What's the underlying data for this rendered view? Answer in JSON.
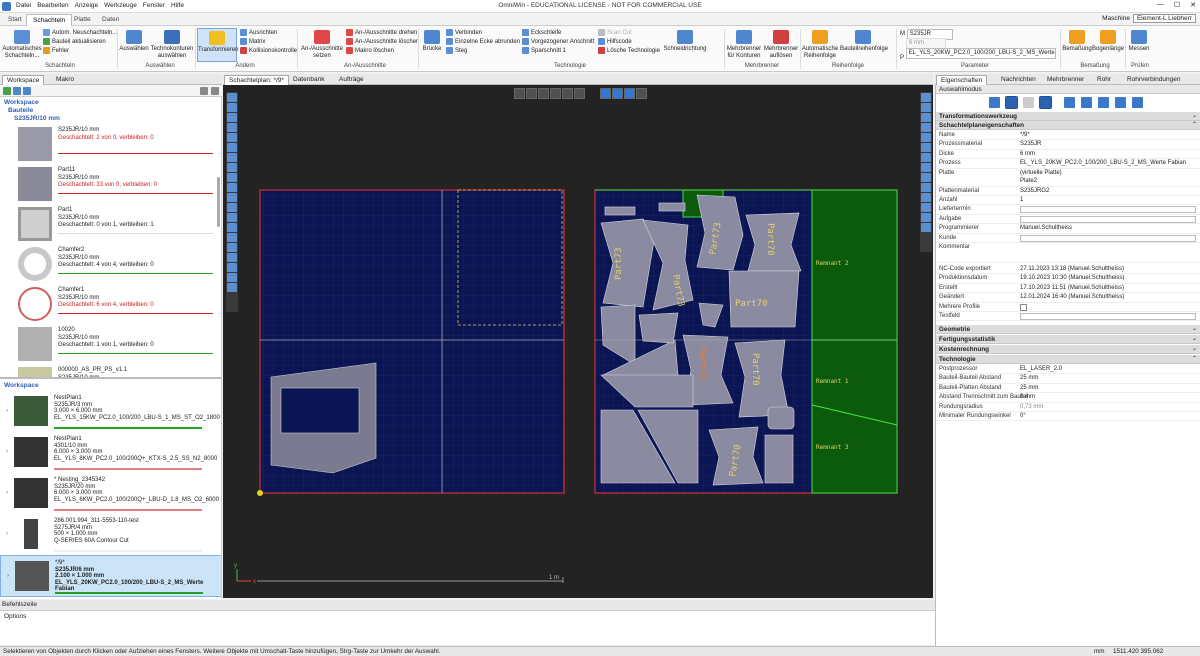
{
  "titlebar": {
    "menu": [
      "Datei",
      "Bearbeiten",
      "Anzeige",
      "Werkzeuge",
      "Fenster",
      "Hilfe"
    ],
    "title": "OmniWin - EDUCATIONAL LICENSE - NOT FOR COMMERCIAL USE",
    "controls": {
      "minimize": "—",
      "maximize": "☐",
      "close": "✕"
    }
  },
  "ribbon_tabs": {
    "tabs": [
      "Start",
      "Schachteln",
      "Platte",
      "Daten"
    ],
    "active": "Schachteln",
    "machine_label": "Maschine",
    "machine_value": "Element-L Liebherr"
  },
  "ribbon": {
    "schachteln": {
      "auto_label": "Automatisches Schachteln...",
      "small": [
        "Autom. Neuschachteln...",
        "Bauteil aktualisieren",
        "Fehler"
      ],
      "group": "Schachteln"
    },
    "auswahlen": {
      "select_label": "Auswählen",
      "contours_label": "Technokonturen auswählen",
      "group": "Auswählen"
    },
    "andern": {
      "transform_label": "Transformieren",
      "small": [
        "Ausrichten",
        "Matrix",
        "Kollisionskontrolle"
      ],
      "group": "Ändern"
    },
    "anaus": {
      "set_label": "An-/Ausschnitte setzen",
      "small": [
        "An-/Ausschnitte drehen",
        "An-/Ausschnitte löschen",
        "Makro löschen"
      ],
      "group": "An-/Ausschnitte"
    },
    "technologie": {
      "bridges_label": "Brücke",
      "small_a": [
        "Verbinden",
        "Einzelne Ecke abrunden",
        "Steg"
      ],
      "small_b": [
        "Eckschleife",
        "Vorgezogener Anschnitt",
        "Sparschnitt 1"
      ],
      "small_c": [
        "Scan Cut",
        "Hilfscode",
        "Lösche Technologie"
      ],
      "direction_label": "Schneidrichtung",
      "group": "Technologie"
    },
    "mehrbrenner": {
      "contours_label": "Mehrbrenner für Konturen",
      "dissolve_label": "Mehrbrenner auflösen",
      "group": "Mehrbrenner"
    },
    "reihenfolge": {
      "auto_label": "Automatische Reihenfolge",
      "parts_label": "Bauteilreihenfolge",
      "group": "Reihenfolge"
    },
    "parameter": {
      "m_label": "M",
      "material": "S235JR",
      "thickness": "6 mm",
      "p_label": "P",
      "process": "EL_YLS_20KW_PC2.0_100/200_LBU-S_2_MS_Werte Fabian",
      "group": "Parameter"
    },
    "bemassung": {
      "dim_label": "Bemaßung",
      "arc_label": "Bogenlänge",
      "group": "Bemaßung"
    },
    "prufen": {
      "measure_label": "Messen",
      "group": "Prüfen"
    }
  },
  "left_panel": {
    "tabs": [
      "Workspace",
      "Makro"
    ],
    "section_workspace": "Workspace",
    "section_parts": "Bauteile",
    "material_group": "S235JR/10 mm",
    "parts": [
      {
        "name": "",
        "material": "S235JR/10 mm",
        "status": "Geschachtelt: 2 von 0, verbleiben: 0",
        "status_color": "#d02020",
        "line_color": "#d02020"
      },
      {
        "name": "Part11",
        "material": "S235JR/10 mm",
        "status": "Geschachtelt: 33 von 0, verbleiben: 0",
        "status_color": "#d02020",
        "line_color": "#d02020"
      },
      {
        "name": "Part1",
        "material": "S235JR/10 mm",
        "status": "Geschachtelt: 0 von 1, verbleiben: 1",
        "status_color": "#222",
        "line_color": "#dddddd"
      },
      {
        "name": "Chamfer2",
        "material": "S235JR/10 mm",
        "status": "Geschachtelt: 4 von 4, verbleiben: 0",
        "status_color": "#222",
        "line_color": "#28a028"
      },
      {
        "name": "Chamfer1",
        "material": "S235JR/10 mm",
        "status": "Geschachtelt: 6 von 4, verbleiben: 0",
        "status_color": "#d02020",
        "line_color": "#d02020"
      },
      {
        "name": "10020",
        "material": "S235JR/10 mm",
        "status": "Geschachtelt: 1 von 1, verbleiben: 0",
        "status_color": "#222",
        "line_color": "#28a028"
      },
      {
        "name": "000000_AS_PR_PS_v1.1",
        "material": "S235JR/10 mm",
        "status": "",
        "status_color": "#222",
        "line_color": "#f0f0f0"
      }
    ],
    "section_workspace2": "Workspace",
    "nests": [
      {
        "name": "NestPlan1",
        "material": "S235JR/3 mm",
        "size": "3.000 × 6.000 mm",
        "process": "EL_YLS_15KW_PC2.0_100/200_LBU-S_1_MS_ST_O2_1800",
        "bar_color": "#28a028"
      },
      {
        "name": "NestPlan1",
        "material": "4301/10 mm",
        "size": "6.000 × 3.000 mm",
        "process": "EL_YLS_8KW_PC2.0_100/200Q+_KTX-S_2.5_SS_N2_8000",
        "bar_color": "#e08080"
      },
      {
        "name": "* Nesting_2345342",
        "material": "S235JR/20 mm",
        "size": "6.000 × 3.000 mm",
        "process": "EL_YLS_6KW_PC2.0_100/200Q+_LBU-D_1.8_MS_O2_6000",
        "bar_color": "#e08080"
      },
      {
        "name": "286.001.994_311-5553-110-test",
        "material": "S275JR/4 mm",
        "size": "500 × 1.000 mm",
        "process": "Q-SERIES 60A Contour Cut",
        "bar_color": "#f0f0f0"
      },
      {
        "name": "*/9*",
        "material": "S235JR/6 mm",
        "size": "2.100 × 1.000 mm",
        "process": "EL_YLS_20KW_PC2.0_100/200_LBU-S_2_MS_Werte Fabian",
        "bar_color": "#28a028"
      }
    ]
  },
  "center": {
    "tabs": [
      "Schachtelplan: */9*",
      "Datenbank",
      "Aufträge"
    ],
    "active": "Schachtelplan: */9*",
    "remnants": [
      "Remnant 2",
      "Remnant 1",
      "Remnant 3"
    ],
    "part_labels": [
      "Part73",
      "Part73",
      "Part73",
      "Part70",
      "Part70",
      "Part73",
      "Part70",
      "Part70"
    ],
    "scale_label": "1 m",
    "axis_x": "x",
    "axis_y": "y"
  },
  "command": {
    "header": "Befehlszeile",
    "body": "Options"
  },
  "status": {
    "text": "Selektieren von Objekten durch Klicken oder Aufziehen eines Fensters. Weitere Objekte mit Umschalt-Taste hinzufügen, Strg-Taste zur Umkehr der Auswahl.",
    "unit": "mm",
    "coords": "1511.420  395.062"
  },
  "right_panel": {
    "tabs": [
      "Eigenschaften",
      "Nachrichten",
      "Mehrbrenner",
      "Rohr",
      "Rohrverbindungen"
    ],
    "mode_header": "Auswahlmodus",
    "sec_transform": "Transformationswerkzeug",
    "sec_props": "Schachtelplaneigenschaften",
    "props": [
      {
        "k": "Name",
        "v": "*/9*"
      },
      {
        "k": "Prozessmaterial",
        "v": "S235JR"
      },
      {
        "k": "Dicke",
        "v": "6 mm"
      },
      {
        "k": "Prozess",
        "v": "EL_YLS_20KW_PC2.0_100/200_LBU-S_2_MS_Werte Fabian"
      },
      {
        "k": "Platte",
        "v": "(virtuelle Platte)\nPlate2"
      },
      {
        "k": "Plattenmaterial",
        "v": "S235JRG2"
      },
      {
        "k": "Anzahl",
        "v": "1"
      },
      {
        "k": "Liefertermin",
        "v": ""
      },
      {
        "k": "Aufgabe",
        "v": ""
      },
      {
        "k": "Programmierer",
        "v": "Manuel.Schultheiss"
      },
      {
        "k": "Kunde",
        "v": ""
      },
      {
        "k": "Kommentar",
        "v": ""
      },
      {
        "k": "NC-Code exportiert",
        "v": "27.11.2023 13:18 (Manuel.Schultheiss)"
      },
      {
        "k": "Produktionsdatum",
        "v": "19.10.2023 10:30 (Manuel.Schultheiss)"
      },
      {
        "k": "Erstellt",
        "v": "17.10.2023 11:51 (Manuel.Schultheiss)"
      },
      {
        "k": "Geändert",
        "v": "12.01.2024 16:40 (Manuel.Schultheiss)"
      },
      {
        "k": "Mehrere Profile",
        "v": ""
      },
      {
        "k": "Testfeld",
        "v": ""
      }
    ],
    "sec_geometry": "Geometrie",
    "sec_stats": "Fertigungsstatistik",
    "sec_costs": "Kostenrechnung",
    "sec_tech": "Technologie",
    "tech": [
      {
        "k": "Postprozessor",
        "v": "EL_LASER_2.0"
      },
      {
        "k": "Bauteil-Bauteil Abstand",
        "v": "25 mm"
      },
      {
        "k": "Bauteil-Platten Abstand",
        "v": "25 mm"
      },
      {
        "k": "Abstand Trennschnitt zum Bauteil",
        "v": "0 mm"
      },
      {
        "k": "Rundungsradius",
        "v": "0,73 mm"
      },
      {
        "k": "Minimaler Rundungswinkel",
        "v": "0°"
      }
    ]
  }
}
